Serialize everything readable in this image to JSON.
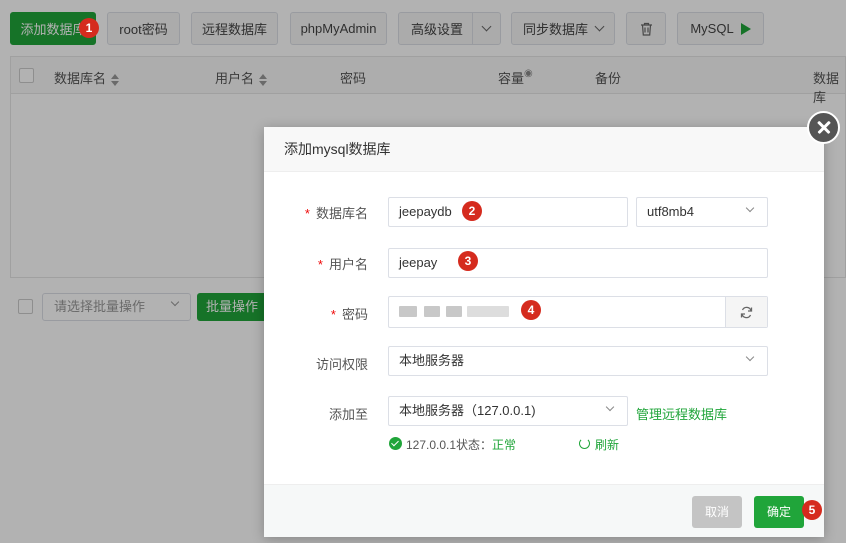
{
  "toolbar": {
    "add_db": "添加数据库",
    "root_pwd": "root密码",
    "remote_db": "远程数据库",
    "phpmyadmin": "phpMyAdmin",
    "advanced": "高级设置",
    "sync_db": "同步数据库",
    "mysql": "MySQL"
  },
  "table": {
    "headers": {
      "dbname": "数据库名",
      "username": "用户名",
      "password": "密码",
      "capacity": "容量",
      "backup": "备份",
      "dbname_right": "数据库"
    }
  },
  "footer": {
    "batch_placeholder": "请选择批量操作",
    "batch_btn": "批量操作"
  },
  "badges": [
    "1",
    "2",
    "3",
    "4",
    "5"
  ],
  "modal": {
    "title": "添加mysql数据库",
    "fields": {
      "dbname_label": "数据库名",
      "dbname_value": "jeepaydb",
      "charset_value": "utf8mb4",
      "username_label": "用户名",
      "username_value": "jeepay",
      "password_label": "密码",
      "access_label": "访问权限",
      "access_value": "本地服务器",
      "addto_label": "添加至",
      "addto_value": "本地服务器（127.0.0.1)",
      "manage_remote": "管理远程数据库",
      "status_prefix": "127.0.0.1状态：",
      "status_value": "正常",
      "refresh": "刷新"
    },
    "cancel": "取消",
    "confirm": "确定"
  },
  "colors": {
    "brand_green": "#20a53a",
    "badge_red": "#d52b1e",
    "required_star": "#ef0808"
  }
}
